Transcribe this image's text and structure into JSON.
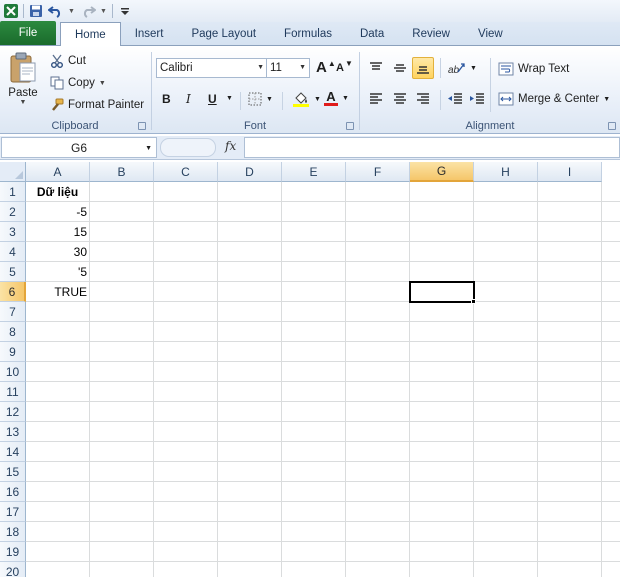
{
  "qat": {
    "icons": [
      "excel-logo-icon",
      "save-icon",
      "undo-icon",
      "redo-icon",
      "customize-qat-icon"
    ]
  },
  "tabs": [
    "File",
    "Home",
    "Insert",
    "Page Layout",
    "Formulas",
    "Data",
    "Review",
    "View"
  ],
  "clipboard": {
    "paste": "Paste",
    "cut": "Cut",
    "copy": "Copy",
    "format_painter": "Format Painter",
    "label": "Clipboard"
  },
  "font": {
    "family": "Calibri",
    "size": "11",
    "grow_glyph": "A",
    "shrink_glyph": "A",
    "bold": "B",
    "italic": "I",
    "underline": "U",
    "font_color_glyph": "A",
    "label": "Font",
    "font_color": "#e01b1b",
    "fill_color": "#ffff00"
  },
  "alignment": {
    "wrap_text": "Wrap Text",
    "merge_center": "Merge & Center",
    "label": "Alignment"
  },
  "formula_bar": {
    "name_box": "G6",
    "fx": "fx",
    "value": ""
  },
  "columns": [
    "A",
    "B",
    "C",
    "D",
    "E",
    "F",
    "G",
    "H",
    "I"
  ],
  "rows": [
    "1",
    "2",
    "3",
    "4",
    "5",
    "6",
    "7",
    "8",
    "9",
    "10",
    "11",
    "12",
    "13",
    "14",
    "15",
    "16",
    "17",
    "18",
    "19",
    "20"
  ],
  "active_cell": {
    "column": "G",
    "row": "6"
  },
  "cells": {
    "A1": "Dữ liệu",
    "A2": "-5",
    "A3": "15",
    "A4": "30",
    "A5": "'5",
    "A6": "TRUE"
  }
}
